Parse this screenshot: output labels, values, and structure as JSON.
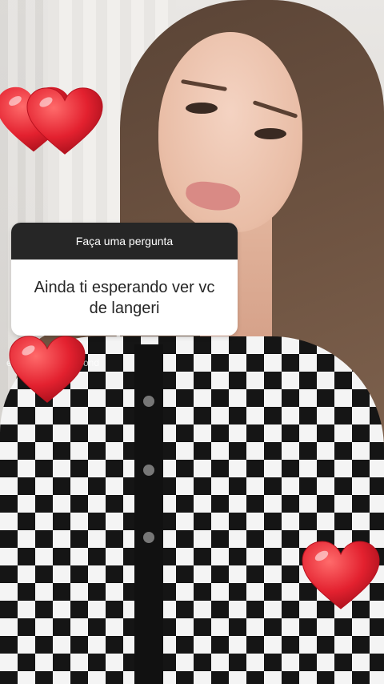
{
  "question_sticker": {
    "prompt_label": "Faça uma pergunta",
    "question_text": "Ainda ti esperando ver vc de langeri"
  },
  "partial_caption": {
    "left": "e",
    "right": "ond"
  },
  "stickers": [
    {
      "icon": "heart-icon",
      "color": "#e3212f"
    },
    {
      "icon": "heart-icon",
      "color": "#e3212f"
    },
    {
      "icon": "heart-icon",
      "color": "#e3212f"
    },
    {
      "icon": "heart-icon",
      "color": "#e3212f"
    }
  ]
}
